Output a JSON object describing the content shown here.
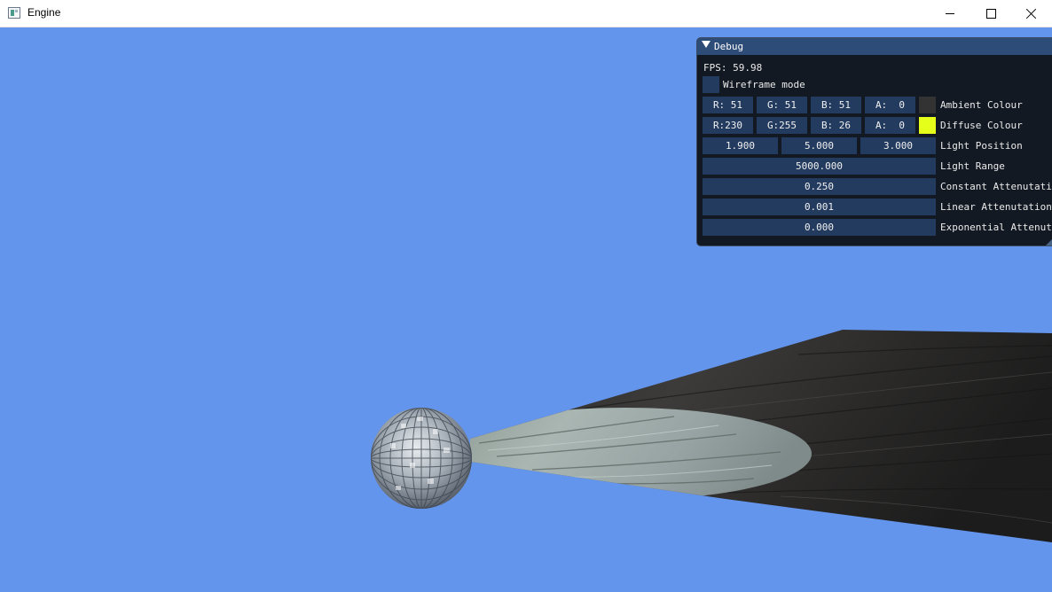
{
  "window": {
    "title": "Engine",
    "icon": "app-window-icon",
    "controls": [
      "minimize",
      "maximize",
      "close"
    ]
  },
  "viewport": {
    "clear_color": "#6495ed"
  },
  "debug": {
    "title": "Debug",
    "fps_text": "FPS: 59.98",
    "wireframe": {
      "label": "Wireframe mode",
      "checked": false
    },
    "ambient": {
      "r": "R: 51",
      "g": "G: 51",
      "b": "B: 51",
      "a": "A:  0",
      "label": "Ambient Colour",
      "swatch_color": "#333333"
    },
    "diffuse": {
      "r": "R:230",
      "g": "G:255",
      "b": "B: 26",
      "a": "A:  0",
      "label": "Diffuse Colour",
      "swatch_color": "#e6ff1a"
    },
    "light_position": {
      "x": "1.900",
      "y": "5.000",
      "z": "3.000",
      "label": "Light Position"
    },
    "light_range": {
      "value": "5000.000",
      "label": "Light Range"
    },
    "constant_attenuation": {
      "value": "0.250",
      "label": "Constant Attenutation"
    },
    "linear_attenuation": {
      "value": "0.001",
      "label": "Linear Attenutation"
    },
    "exponential_attenuation": {
      "value": "0.000",
      "label": "Exponential Attenutation"
    }
  }
}
